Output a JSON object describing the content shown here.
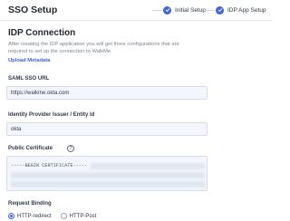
{
  "header": {
    "title": "SSO Setup",
    "steps": [
      {
        "label": "Initial Setup",
        "status": "completed"
      },
      {
        "label": "IDP App Setup",
        "status": "completed"
      }
    ]
  },
  "section": {
    "title": "IDP Connection",
    "intro_line1": "After creating the IDP application you will get three configurations that are",
    "intro_line2": "required to set up the connection to WalkMe",
    "upload_link": "Upload Metadata"
  },
  "fields": {
    "saml_sso_url": {
      "label": "SAML SSO URL",
      "value": "https://walkme.okta.com"
    },
    "issuer": {
      "label": "Identity Provider Issuer / Entity Id",
      "value": "okta"
    },
    "certificate": {
      "label": "Public Certificate",
      "value": "-----BEGIN CERTIFICATE-----"
    }
  },
  "request_binding": {
    "label": "Request Binding",
    "options": [
      {
        "label": "HTTP-redirect",
        "selected": true
      },
      {
        "label": "HTTP-Post",
        "selected": false
      }
    ]
  },
  "colors": {
    "accent": "#3f63d8",
    "field_bg": "#f3f6fc"
  },
  "icons": {
    "step": "check-icon",
    "info": "info-icon"
  }
}
